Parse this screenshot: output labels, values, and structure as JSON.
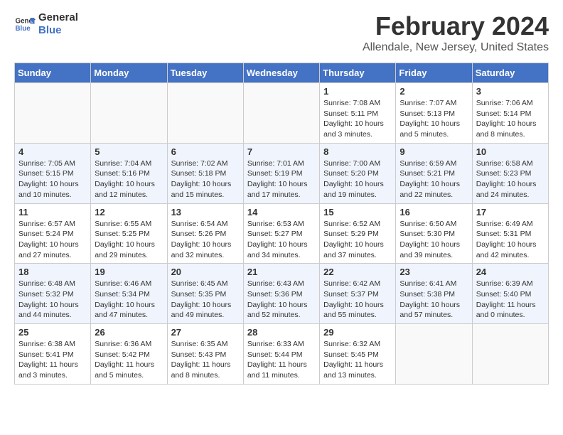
{
  "logo": {
    "line1": "General",
    "line2": "Blue"
  },
  "title": "February 2024",
  "location": "Allendale, New Jersey, United States",
  "headers": [
    "Sunday",
    "Monday",
    "Tuesday",
    "Wednesday",
    "Thursday",
    "Friday",
    "Saturday"
  ],
  "weeks": [
    [
      {
        "num": "",
        "info": ""
      },
      {
        "num": "",
        "info": ""
      },
      {
        "num": "",
        "info": ""
      },
      {
        "num": "",
        "info": ""
      },
      {
        "num": "1",
        "info": "Sunrise: 7:08 AM\nSunset: 5:11 PM\nDaylight: 10 hours\nand 3 minutes."
      },
      {
        "num": "2",
        "info": "Sunrise: 7:07 AM\nSunset: 5:13 PM\nDaylight: 10 hours\nand 5 minutes."
      },
      {
        "num": "3",
        "info": "Sunrise: 7:06 AM\nSunset: 5:14 PM\nDaylight: 10 hours\nand 8 minutes."
      }
    ],
    [
      {
        "num": "4",
        "info": "Sunrise: 7:05 AM\nSunset: 5:15 PM\nDaylight: 10 hours\nand 10 minutes."
      },
      {
        "num": "5",
        "info": "Sunrise: 7:04 AM\nSunset: 5:16 PM\nDaylight: 10 hours\nand 12 minutes."
      },
      {
        "num": "6",
        "info": "Sunrise: 7:02 AM\nSunset: 5:18 PM\nDaylight: 10 hours\nand 15 minutes."
      },
      {
        "num": "7",
        "info": "Sunrise: 7:01 AM\nSunset: 5:19 PM\nDaylight: 10 hours\nand 17 minutes."
      },
      {
        "num": "8",
        "info": "Sunrise: 7:00 AM\nSunset: 5:20 PM\nDaylight: 10 hours\nand 19 minutes."
      },
      {
        "num": "9",
        "info": "Sunrise: 6:59 AM\nSunset: 5:21 PM\nDaylight: 10 hours\nand 22 minutes."
      },
      {
        "num": "10",
        "info": "Sunrise: 6:58 AM\nSunset: 5:23 PM\nDaylight: 10 hours\nand 24 minutes."
      }
    ],
    [
      {
        "num": "11",
        "info": "Sunrise: 6:57 AM\nSunset: 5:24 PM\nDaylight: 10 hours\nand 27 minutes."
      },
      {
        "num": "12",
        "info": "Sunrise: 6:55 AM\nSunset: 5:25 PM\nDaylight: 10 hours\nand 29 minutes."
      },
      {
        "num": "13",
        "info": "Sunrise: 6:54 AM\nSunset: 5:26 PM\nDaylight: 10 hours\nand 32 minutes."
      },
      {
        "num": "14",
        "info": "Sunrise: 6:53 AM\nSunset: 5:27 PM\nDaylight: 10 hours\nand 34 minutes."
      },
      {
        "num": "15",
        "info": "Sunrise: 6:52 AM\nSunset: 5:29 PM\nDaylight: 10 hours\nand 37 minutes."
      },
      {
        "num": "16",
        "info": "Sunrise: 6:50 AM\nSunset: 5:30 PM\nDaylight: 10 hours\nand 39 minutes."
      },
      {
        "num": "17",
        "info": "Sunrise: 6:49 AM\nSunset: 5:31 PM\nDaylight: 10 hours\nand 42 minutes."
      }
    ],
    [
      {
        "num": "18",
        "info": "Sunrise: 6:48 AM\nSunset: 5:32 PM\nDaylight: 10 hours\nand 44 minutes."
      },
      {
        "num": "19",
        "info": "Sunrise: 6:46 AM\nSunset: 5:34 PM\nDaylight: 10 hours\nand 47 minutes."
      },
      {
        "num": "20",
        "info": "Sunrise: 6:45 AM\nSunset: 5:35 PM\nDaylight: 10 hours\nand 49 minutes."
      },
      {
        "num": "21",
        "info": "Sunrise: 6:43 AM\nSunset: 5:36 PM\nDaylight: 10 hours\nand 52 minutes."
      },
      {
        "num": "22",
        "info": "Sunrise: 6:42 AM\nSunset: 5:37 PM\nDaylight: 10 hours\nand 55 minutes."
      },
      {
        "num": "23",
        "info": "Sunrise: 6:41 AM\nSunset: 5:38 PM\nDaylight: 10 hours\nand 57 minutes."
      },
      {
        "num": "24",
        "info": "Sunrise: 6:39 AM\nSunset: 5:40 PM\nDaylight: 11 hours\nand 0 minutes."
      }
    ],
    [
      {
        "num": "25",
        "info": "Sunrise: 6:38 AM\nSunset: 5:41 PM\nDaylight: 11 hours\nand 3 minutes."
      },
      {
        "num": "26",
        "info": "Sunrise: 6:36 AM\nSunset: 5:42 PM\nDaylight: 11 hours\nand 5 minutes."
      },
      {
        "num": "27",
        "info": "Sunrise: 6:35 AM\nSunset: 5:43 PM\nDaylight: 11 hours\nand 8 minutes."
      },
      {
        "num": "28",
        "info": "Sunrise: 6:33 AM\nSunset: 5:44 PM\nDaylight: 11 hours\nand 11 minutes."
      },
      {
        "num": "29",
        "info": "Sunrise: 6:32 AM\nSunset: 5:45 PM\nDaylight: 11 hours\nand 13 minutes."
      },
      {
        "num": "",
        "info": ""
      },
      {
        "num": "",
        "info": ""
      }
    ]
  ]
}
